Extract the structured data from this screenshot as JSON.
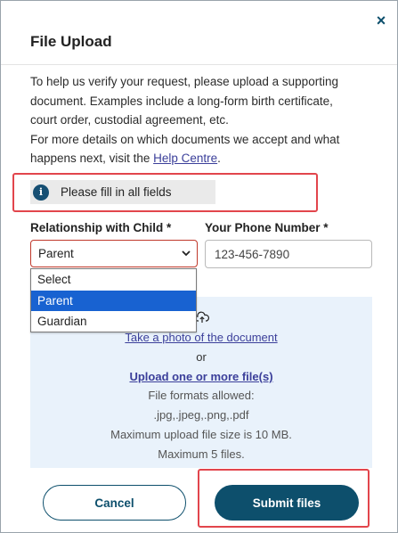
{
  "dialog": {
    "title": "File Upload",
    "close_label": "×"
  },
  "description": {
    "line1": "To help us verify your request, please upload a supporting",
    "line2": "document. Examples include a long-form birth certificate,",
    "line3": "court order, custodial agreement, etc.",
    "line4": "For more details on which documents we accept and what",
    "line5_prefix": "happens next, visit the ",
    "line5_link": "Help Centre",
    "line5_suffix": "."
  },
  "alert": {
    "icon": "info-icon",
    "icon_glyph": "i",
    "text": "Please fill in all fields",
    "accent": "#164f73"
  },
  "form": {
    "relationship_label": "Relationship with Child *",
    "relationship_value": "Parent",
    "relationship_options": [
      {
        "label": "Select",
        "selected": false
      },
      {
        "label": "Parent",
        "selected": true
      },
      {
        "label": "Guardian",
        "selected": false
      }
    ],
    "phone_label": "Your Phone Number *",
    "phone_value": "123-456-7890"
  },
  "upload": {
    "icon": "cloud-upload-icon",
    "take_photo": "Take a photo of the document",
    "or": "or",
    "upload_files": "Upload one or more file(s)",
    "formats_label": "File formats allowed:",
    "formats": ".jpg,.jpeg,.png,.pdf",
    "max_size": "Maximum upload file size is 10 MB.",
    "max_files": "Maximum 5 files."
  },
  "actions": {
    "cancel": "Cancel",
    "submit": "Submit files"
  },
  "colors": {
    "primary": "#0d4f6c",
    "highlight_outline": "#e2454c",
    "upload_bg": "#e9f2fb",
    "dropdown_selected": "#1862d1"
  }
}
